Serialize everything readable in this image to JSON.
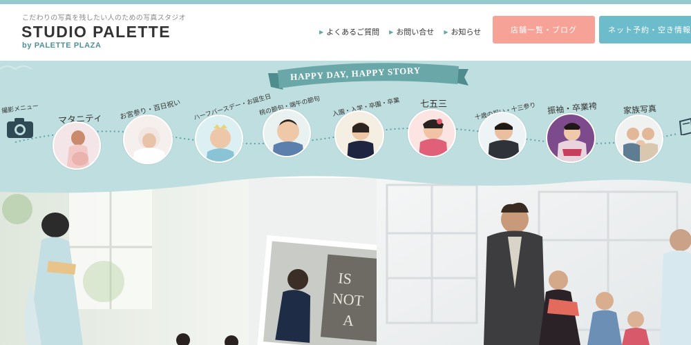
{
  "header": {
    "tagline": "こだわりの写真を残したい人のための写真スタジオ",
    "logo": "STUDIO PALETTE",
    "logo_sub": "by PALETTE PLAZA",
    "nav": [
      {
        "label": "よくあるご質問"
      },
      {
        "label": "お問い合せ"
      },
      {
        "label": "お知らせ"
      }
    ],
    "btn_shop": "店舗一覧・ブログ",
    "btn_reserve": "ネット予約・空き情報"
  },
  "menu": {
    "ribbon": "HAPPY DAY, HAPPY STORY",
    "camera_label": "撮影メニュー",
    "items": [
      {
        "label": "マタニティ"
      },
      {
        "label": "お宮参り・百日祝い"
      },
      {
        "label": "ハーフバースデー・お誕生日"
      },
      {
        "label": "桃の節句・端午の節句"
      },
      {
        "label": "入園・入学・卒園・卒業"
      },
      {
        "label": "七五三"
      },
      {
        "label": "十歳の祝い・十三参り"
      },
      {
        "label": "振袖・卒業袴"
      },
      {
        "label": "家族写真"
      }
    ]
  },
  "colors": {
    "band": "#bfdedf",
    "ribbon": "#6aa7a8",
    "accent_pink": "#f6a296",
    "accent_teal": "#6dbccb"
  },
  "photo": {
    "sign_lines": [
      "IS",
      "NOT",
      "A"
    ]
  }
}
